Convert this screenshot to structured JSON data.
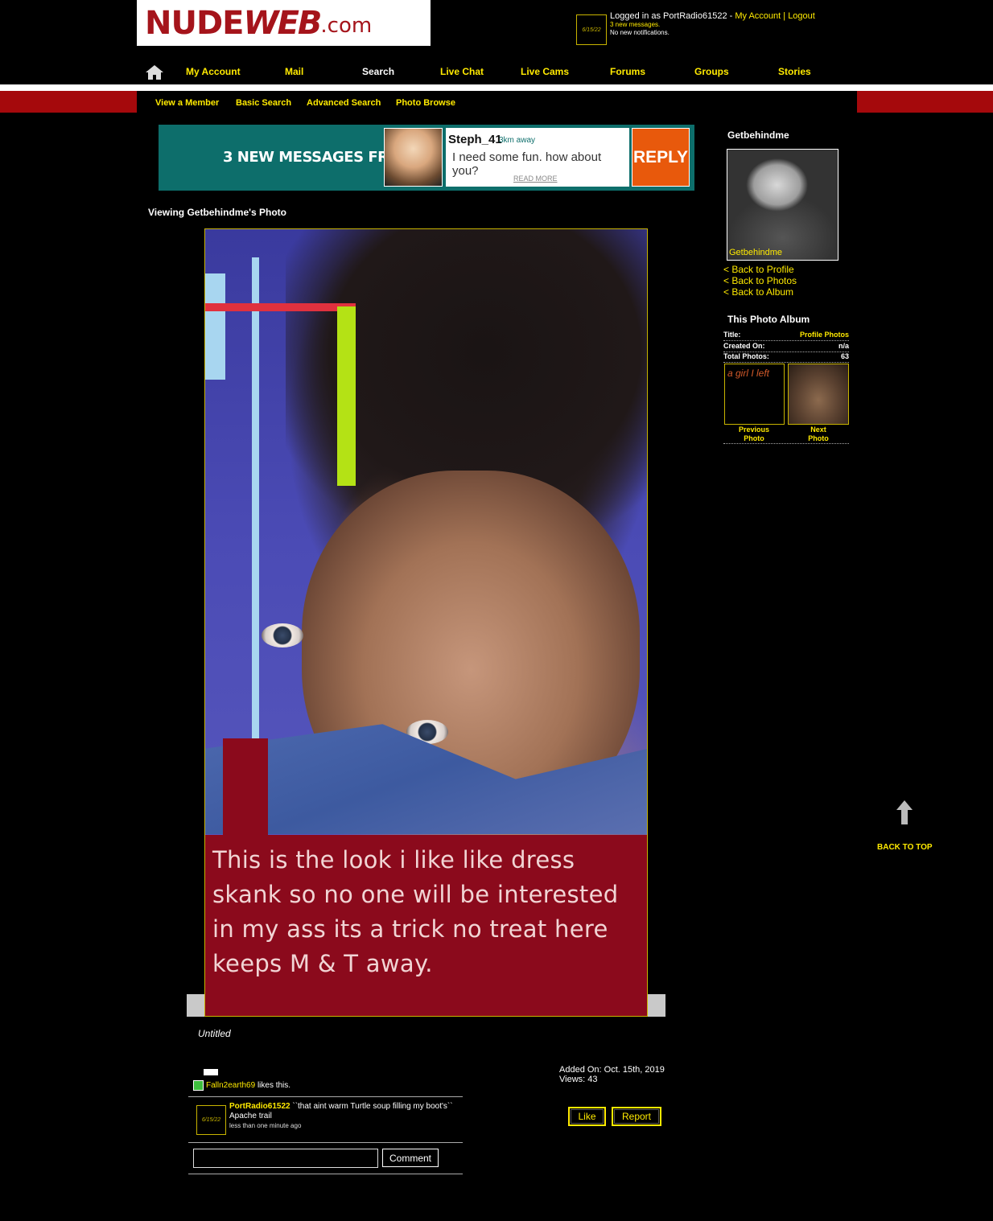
{
  "header": {
    "logo": {
      "part1": "NUDE",
      "part2": "WEB",
      "part3": ".com"
    },
    "avatar_date": "6/15/22",
    "login_prefix": "Logged in as PortRadio61522 -",
    "my_account": "My Account",
    "separator": "|",
    "logout": "Logout",
    "messages": "3 new messages.",
    "notifications": "No new notifications."
  },
  "nav": {
    "items": [
      "My Account",
      "Mail",
      "Search",
      "Live Chat",
      "Live Cams",
      "Forums",
      "Groups",
      "Stories"
    ],
    "colors": [
      "#ffea00",
      "#ffea00",
      "#ffffff",
      "#ffea00",
      "#ffea00",
      "#ffea00",
      "#ffea00",
      "#ffea00"
    ]
  },
  "subnav": {
    "items": [
      "View a Member",
      "Basic Search",
      "Advanced Search",
      "Photo Browse"
    ]
  },
  "ad": {
    "headline": "3 NEW MESSAGES FROM",
    "name": "Steph_41",
    "distance": "3km away",
    "message": "I need some fun. how about you?",
    "read_more": "READ MORE",
    "reply": "REPLY"
  },
  "page": {
    "title": "Viewing Getbehindme's Photo"
  },
  "photo": {
    "caption_lines": [
      "This is the look i like like dress",
      "skank so no one will be interested",
      "in my ass its a trick no treat here",
      "keeps M & T away."
    ],
    "title": "Untitled"
  },
  "likes": {
    "user": "Falln2earth69",
    "text": "likes this."
  },
  "comment": {
    "avatar_date": "6/15/22",
    "user": "PortRadio61522",
    "text": " ``that aint warm Turtle soup filling my boot's`` Apache trail",
    "time": "less than one minute ago",
    "button": "Comment"
  },
  "meta": {
    "added": "Added On: Oct. 15th, 2019",
    "views": "Views: 43",
    "like_button": "Like",
    "report_button": "Report"
  },
  "sidebar": {
    "username": "Getbehindme",
    "photo_name": "Getbehindme",
    "links": [
      "< Back to Profile",
      "< Back to Photos",
      "< Back to Album"
    ],
    "album_heading": "This Photo Album",
    "rows": [
      {
        "label": "Title:",
        "value": "Profile Photos"
      },
      {
        "label": "Created On:",
        "value": "n/a"
      },
      {
        "label": "Total Photos:",
        "value": "63"
      }
    ],
    "prev_thumb_text": "a girl I left",
    "prev_label": "Previous Photo",
    "next_label": "Next Photo"
  },
  "back_to_top": "BACK TO TOP"
}
